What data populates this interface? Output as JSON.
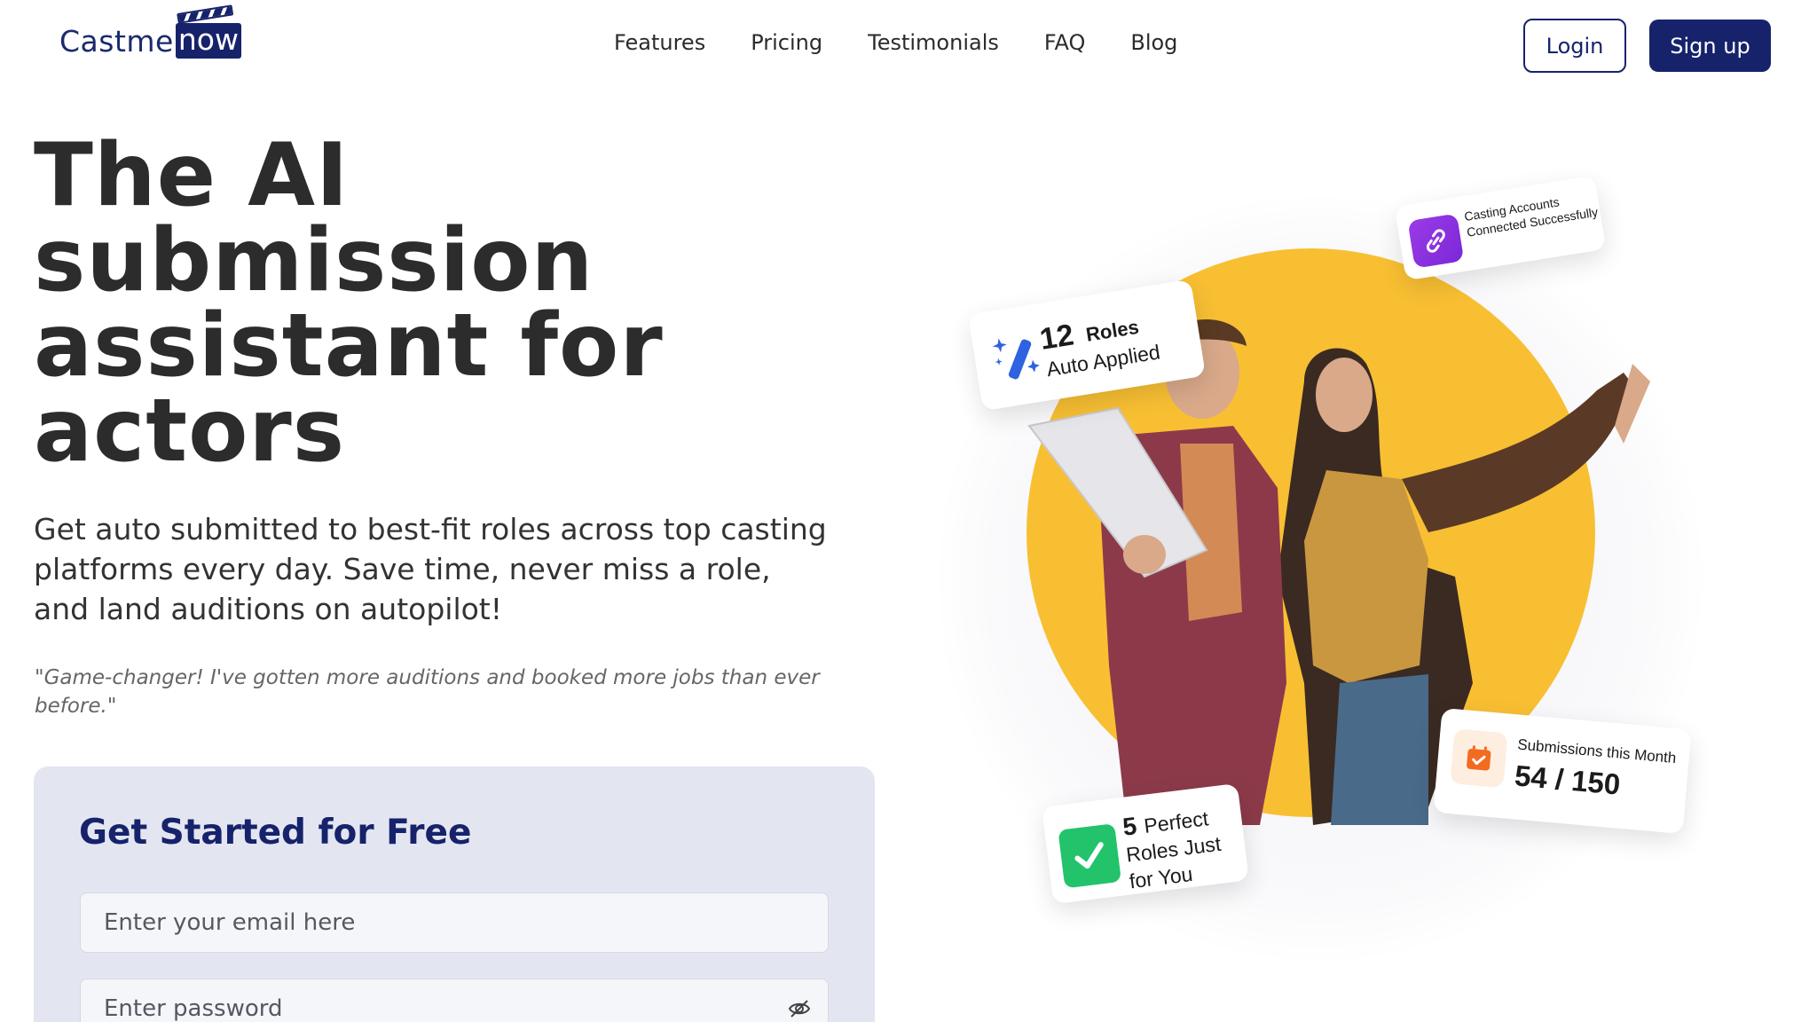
{
  "brand": {
    "name_part1": "Castme",
    "name_part2": "now"
  },
  "nav": {
    "links": [
      "Features",
      "Pricing",
      "Testimonials",
      "FAQ",
      "Blog"
    ],
    "login_label": "Login",
    "signup_label": "Sign up"
  },
  "hero": {
    "title": "The AI submission assistant for actors",
    "subtitle": "Get auto submitted to best-fit roles across top casting platforms every day. Save time, never miss a role, and land auditions on autopilot!",
    "quote": "\"Game-changer! I've gotten more auditions and booked more jobs than ever before.\""
  },
  "form": {
    "title": "Get Started for Free",
    "email_placeholder": "Enter your email here",
    "password_placeholder": "Enter password"
  },
  "cards": {
    "roles": {
      "number": "12",
      "word": "Roles",
      "sub": "Auto Applied"
    },
    "casting": {
      "text": "Casting Accounts Connected Successfully"
    },
    "perfect": {
      "number": "5",
      "text": "Perfect Roles Just for You"
    },
    "submissions": {
      "label": "Submissions this Month",
      "value": "54 / 150"
    }
  },
  "colors": {
    "brand_navy": "#16236b",
    "accent_yellow": "#f8bf33",
    "form_bg": "#e3e6f1",
    "check_green": "#22c36b",
    "link_purple": "#8b32e0",
    "calendar_orange": "#f26b21"
  },
  "icons": {
    "wand": "magic-wand-icon",
    "link": "link-icon",
    "check": "check-icon",
    "calendar": "calendar-check-icon",
    "eye": "eye-off-icon"
  }
}
